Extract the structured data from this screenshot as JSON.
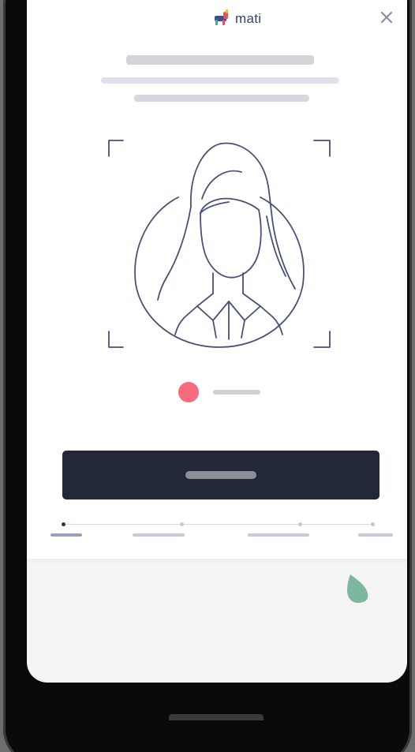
{
  "app": {
    "brand_name": "mati",
    "logo_icon": "mati-llama-logo-icon",
    "colors": {
      "brand_purple": "#3b4260",
      "record_dot": "#f66b7d",
      "primary_button": "#232839",
      "chat_bubble": "#7db7a0"
    }
  },
  "header": {
    "close_icon": "close-icon"
  },
  "content": {
    "illustration_icon": "selfie-face-frame-icon",
    "recording_indicator": "recording-dot-icon"
  },
  "stepper": {
    "steps": 4,
    "active_step": 1
  },
  "chat": {
    "icon": "chat-bubble-icon"
  }
}
